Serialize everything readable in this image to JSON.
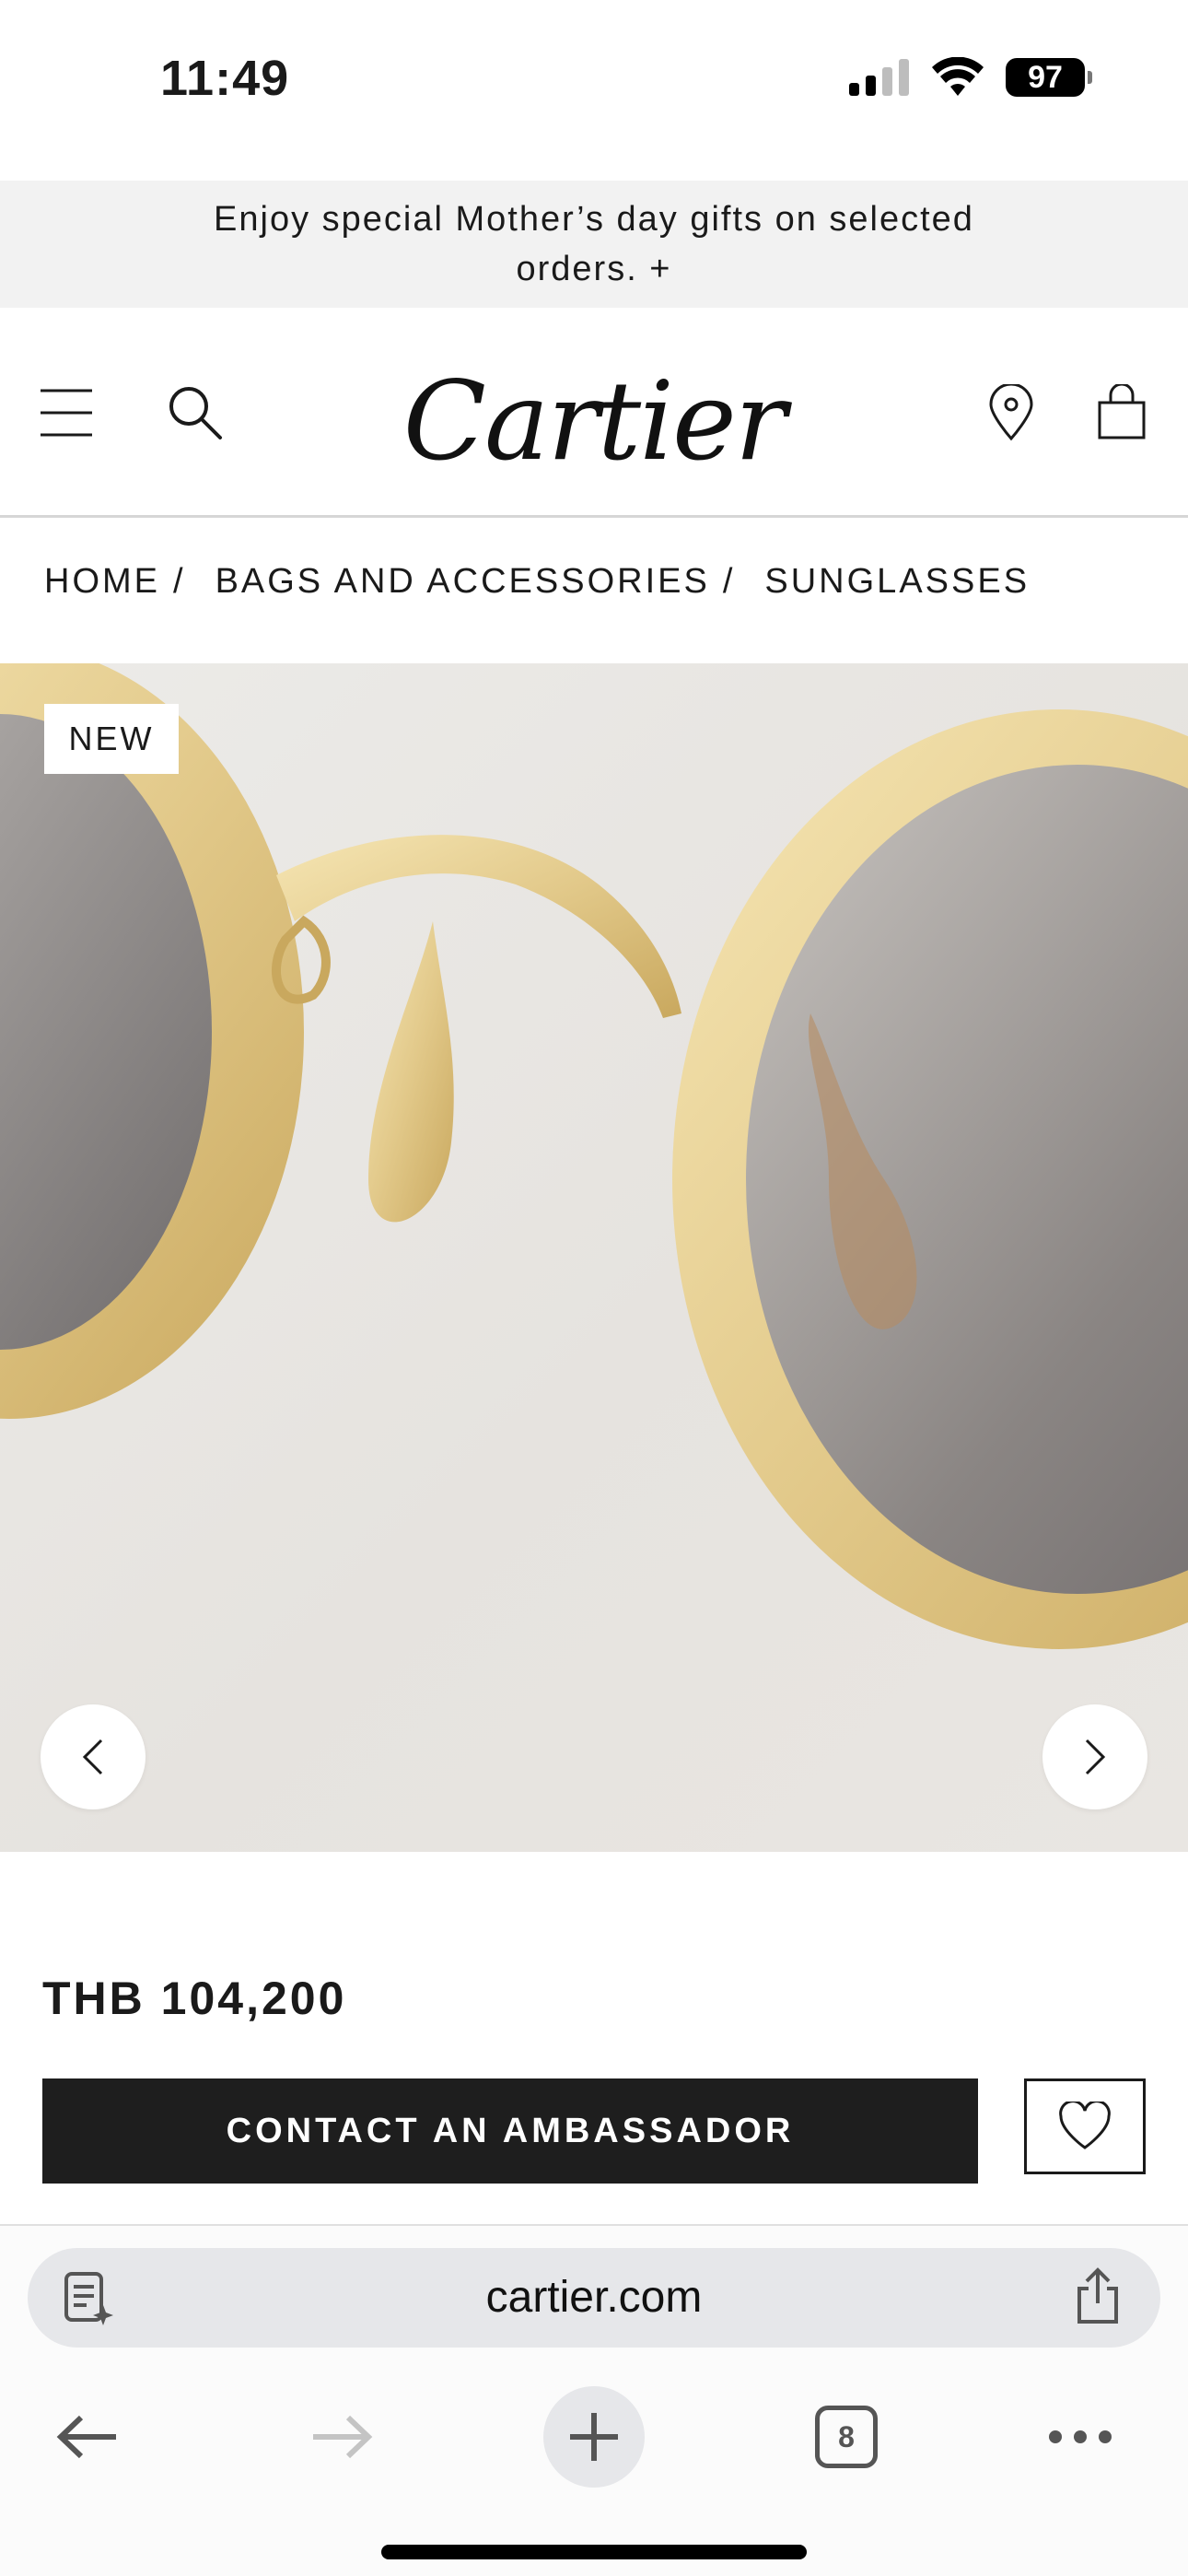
{
  "status_bar": {
    "time": "11:49",
    "battery": "97",
    "icons": [
      "cellular-signal-icon",
      "wifi-icon",
      "battery-icon"
    ]
  },
  "promo": {
    "text": "Enjoy special Mother’s day gifts on selected orders.  +"
  },
  "header": {
    "logo": "Cartier",
    "icons": [
      "menu-icon",
      "search-icon",
      "location-pin-icon",
      "shopping-bag-icon"
    ]
  },
  "breadcrumb": {
    "items": [
      "HOME",
      "BAGS AND ACCESSORIES",
      "SUNGLASSES"
    ],
    "separator": "/"
  },
  "product": {
    "badge": "NEW",
    "price": "THB 104,200",
    "cta_label": "CONTACT AN AMBASSADOR",
    "carousel_icons": [
      "chevron-left-icon",
      "chevron-right-icon"
    ]
  },
  "safari": {
    "url": "cartier.com",
    "tabs_count": "8",
    "icons": [
      "page-menu-icon",
      "share-icon",
      "back-arrow-icon",
      "forward-arrow-icon",
      "new-tab-plus-icon",
      "tabs-icon",
      "more-icon"
    ]
  },
  "colors": {
    "cta_background": "#1e1e1e",
    "promo_background": "#f2f2f2",
    "gold_frame": "#e2c98a"
  }
}
